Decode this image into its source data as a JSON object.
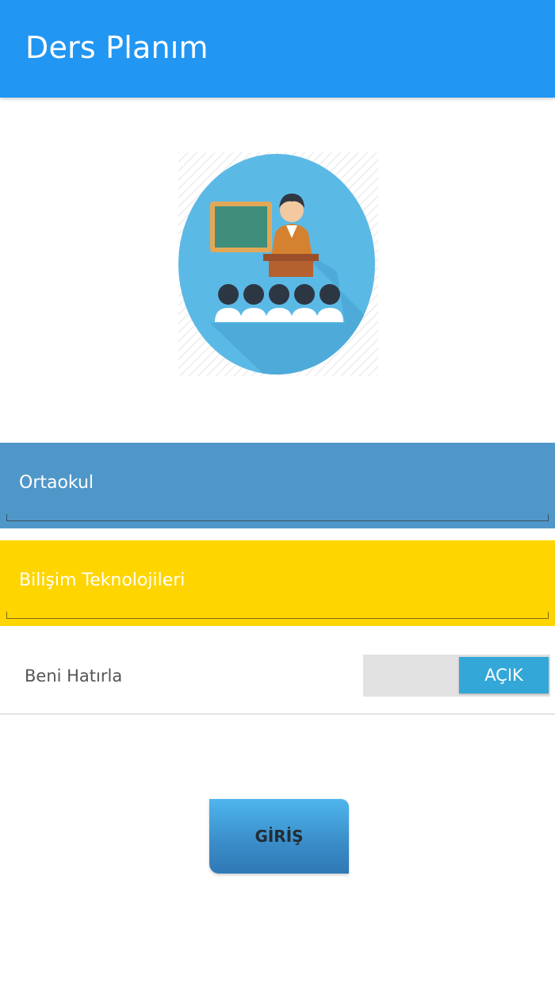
{
  "appbar": {
    "title": "Ders Planım"
  },
  "logo": {
    "icon": "teacher-classroom-icon"
  },
  "form": {
    "school_level": {
      "selected": "Ortaokul"
    },
    "course": {
      "selected": "Bilişim Teknolojileri"
    },
    "remember": {
      "label": "Beni Hatırla",
      "toggle_state": "AÇIK"
    },
    "login_label": "GİRİŞ"
  },
  "colors": {
    "appbar": "#2196F3",
    "school_spinner": "#5097C9",
    "course_spinner": "#FFD500",
    "toggle_on": "#33A7D8"
  }
}
